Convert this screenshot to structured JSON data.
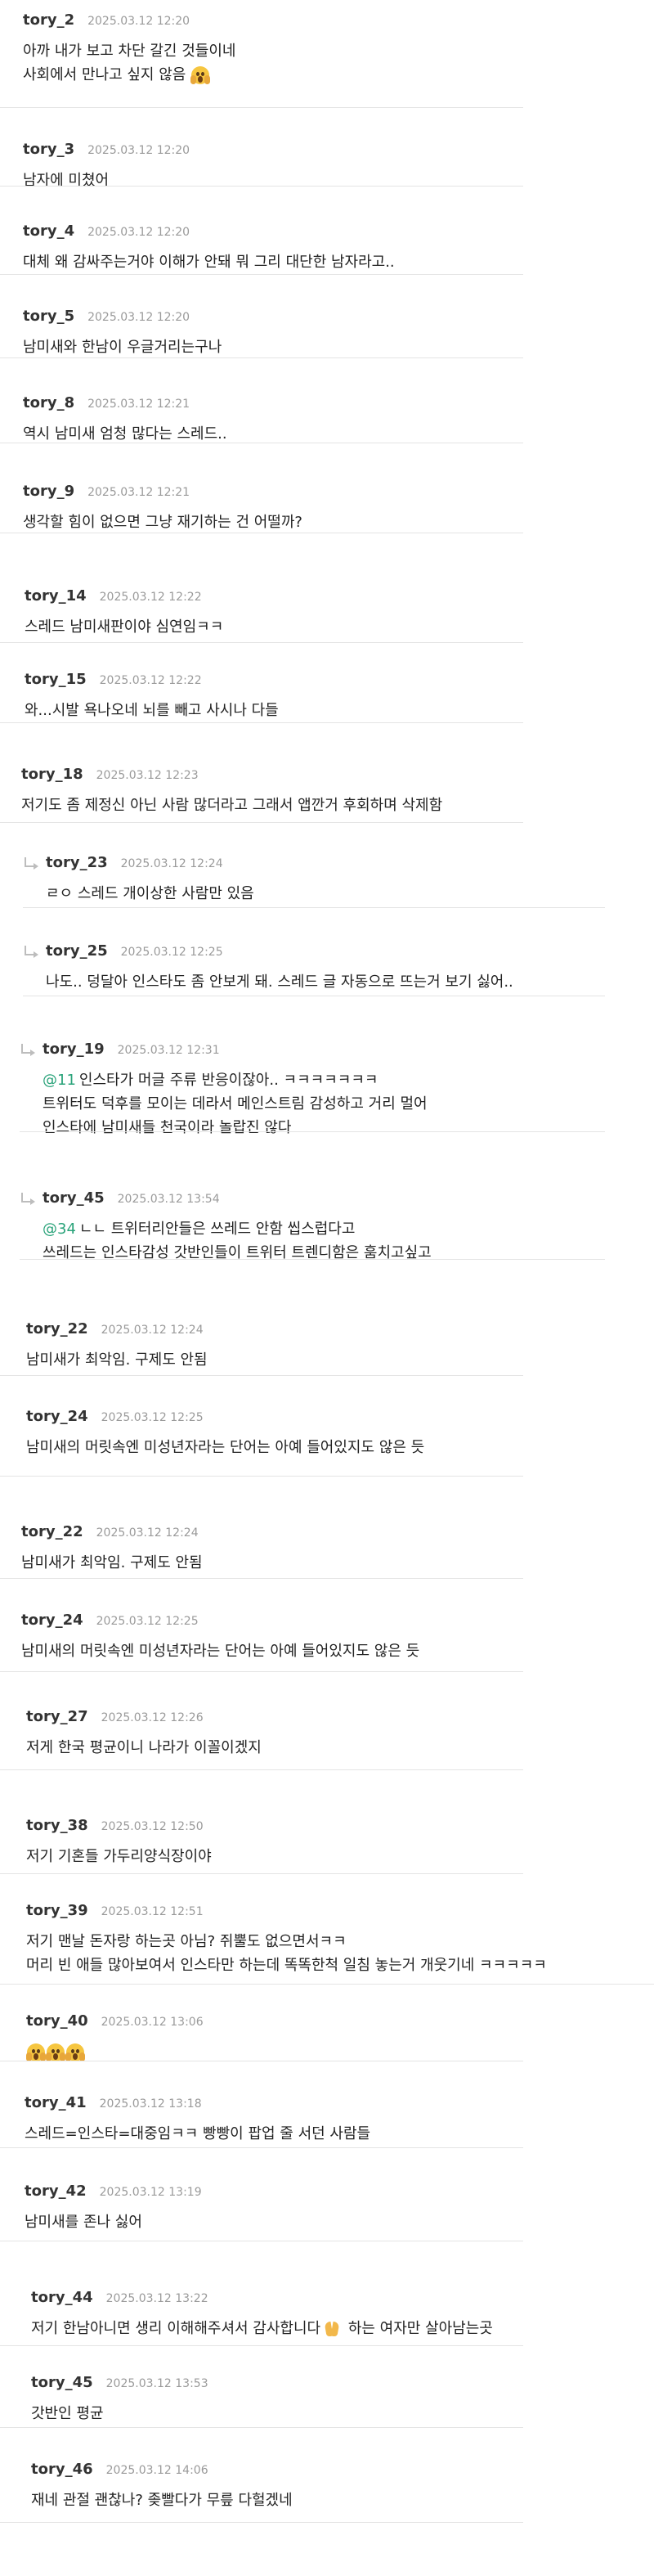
{
  "comments": [
    {
      "author": "tory_2",
      "date": "2025.03.12 12:20",
      "lines": [
        [
          {
            "t": "아까 내가 보고 차단 갈긴 것들이네"
          }
        ],
        [
          {
            "t": "사회에서 만나고 싶지 않음 "
          },
          {
            "e": "scream-icon"
          }
        ]
      ]
    },
    {
      "author": "tory_3",
      "date": "2025.03.12 12:20",
      "lines": [
        [
          {
            "t": "남자에 미쳤어"
          }
        ]
      ]
    },
    {
      "author": "tory_4",
      "date": "2025.03.12 12:20",
      "lines": [
        [
          {
            "t": "대체 왜 감싸주는거야 이해가 안돼 뭐 그리 대단한 남자라고.."
          }
        ]
      ]
    },
    {
      "author": "tory_5",
      "date": "2025.03.12 12:20",
      "lines": [
        [
          {
            "t": "남미새와 한남이 우글거리는구나"
          }
        ]
      ]
    },
    {
      "author": "tory_8",
      "date": "2025.03.12 12:21",
      "lines": [
        [
          {
            "t": "역시 남미새 엄청 많다는 스레드.."
          }
        ]
      ]
    },
    {
      "author": "tory_9",
      "date": "2025.03.12 12:21",
      "lines": [
        [
          {
            "t": "생각할 힘이 없으면 그냥 재기하는 건 어떨까?"
          }
        ]
      ]
    },
    {
      "author": "tory_14",
      "date": "2025.03.12 12:22",
      "lines": [
        [
          {
            "t": "스레드 남미새판이야 심연임ㅋㅋ"
          }
        ]
      ]
    },
    {
      "author": "tory_15",
      "date": "2025.03.12 12:22",
      "lines": [
        [
          {
            "t": "와...시발 욕나오네 뇌를 빼고 사시나 다들"
          }
        ]
      ]
    },
    {
      "author": "tory_18",
      "date": "2025.03.12 12:23",
      "lines": [
        [
          {
            "t": "저기도 좀 제정신 아닌 사람 많더라고 그래서 앱깐거 후회하며 삭제함"
          }
        ]
      ]
    },
    {
      "author": "tory_23",
      "date": "2025.03.12 12:24",
      "lines": [
        [
          {
            "t": "ㄹㅇ 스레드 개이상한 사람만 있음"
          }
        ]
      ]
    },
    {
      "author": "tory_25",
      "date": "2025.03.12 12:25",
      "lines": [
        [
          {
            "t": "나도.. 덩달아 인스타도 좀 안보게 돼. 스레드 글 자동으로 뜨는거 보기 싫어.."
          }
        ]
      ]
    },
    {
      "author": "tory_19",
      "date": "2025.03.12 12:31",
      "lines": [
        [
          {
            "m": "@11"
          },
          {
            "t": "인스타가 머글 주류 반응이잖아.. ㅋㅋㅋㅋㅋㅋㅋ"
          }
        ],
        [
          {
            "t": "트위터도 덕후를 모이는 데라서 메인스트림 감성하고 거리 멀어"
          }
        ],
        [
          {
            "t": "인스타에 남미새들 천국이라 놀랍진 않다"
          }
        ]
      ]
    },
    {
      "author": "tory_45",
      "date": "2025.03.12 13:54",
      "lines": [
        [
          {
            "m": "@34"
          },
          {
            "t": "ㄴㄴ 트위터리안들은 쓰레드 안함 씹스럽다고"
          }
        ],
        [
          {
            "t": "쓰레드는 인스타감성 갓반인들이 트위터 트렌디함은 훔치고싶고"
          }
        ]
      ]
    },
    {
      "author": "tory_22",
      "date": "2025.03.12 12:24",
      "lines": [
        [
          {
            "t": "남미새가 최악임. 구제도 안됨"
          }
        ]
      ]
    },
    {
      "author": "tory_24",
      "date": "2025.03.12 12:25",
      "lines": [
        [
          {
            "t": "남미새의 머릿속엔 미성년자라는 단어는 아예 들어있지도 않은 듯"
          }
        ]
      ]
    },
    {
      "author": "tory_22",
      "date": "2025.03.12 12:24",
      "lines": [
        [
          {
            "t": "남미새가 최악임. 구제도 안됨"
          }
        ]
      ]
    },
    {
      "author": "tory_24",
      "date": "2025.03.12 12:25",
      "lines": [
        [
          {
            "t": "남미새의 머릿속엔 미성년자라는 단어는 아예 들어있지도 않은 듯"
          }
        ]
      ]
    },
    {
      "author": "tory_27",
      "date": "2025.03.12 12:26",
      "lines": [
        [
          {
            "t": "저게 한국 평균이니 나라가 이꼴이겠지"
          }
        ]
      ]
    },
    {
      "author": "tory_38",
      "date": "2025.03.12 12:50",
      "lines": [
        [
          {
            "t": "저기 기혼들 가두리양식장이야"
          }
        ]
      ]
    },
    {
      "author": "tory_39",
      "date": "2025.03.12 12:51",
      "lines": [
        [
          {
            "t": "저기 맨날 돈자랑 하는곳 아님? 쥐뿔도 없으면서ㅋㅋ"
          }
        ],
        [
          {
            "t": "머리 빈 애들 많아보여서 인스타만 하는데 똑똑한척 일침 놓는거 개웃기네 ㅋㅋㅋㅋㅋ"
          }
        ]
      ]
    },
    {
      "author": "tory_40",
      "date": "2025.03.12 13:06",
      "lines": [
        [
          {
            "e": "scream-icon"
          },
          {
            "e": "scream-icon"
          },
          {
            "e": "scream-icon"
          }
        ]
      ]
    },
    {
      "author": "tory_41",
      "date": "2025.03.12 13:18",
      "lines": [
        [
          {
            "t": "스레드=인스타=대중임ㅋㅋ 빵빵이 팝업 줄 서던 사람들"
          }
        ]
      ]
    },
    {
      "author": "tory_42",
      "date": "2025.03.12 13:19",
      "lines": [
        [
          {
            "t": "남미새를 존나 싫어"
          }
        ]
      ]
    },
    {
      "author": "tory_44",
      "date": "2025.03.12 13:22",
      "lines": [
        [
          {
            "t": "저기 한남아니면 생리 이해해주셔서 감사합니다"
          },
          {
            "e": "pray-icon"
          },
          {
            "t": " 하는 여자만 살아남는곳"
          }
        ]
      ]
    },
    {
      "author": "tory_45",
      "date": "2025.03.12 13:53",
      "lines": [
        [
          {
            "t": "갓반인 평균"
          }
        ]
      ]
    },
    {
      "author": "tory_46",
      "date": "2025.03.12 14:06",
      "lines": [
        [
          {
            "t": "재네 관절 괜찮나? 좆빨다가 무릎 다헐겠네"
          }
        ]
      ]
    }
  ]
}
